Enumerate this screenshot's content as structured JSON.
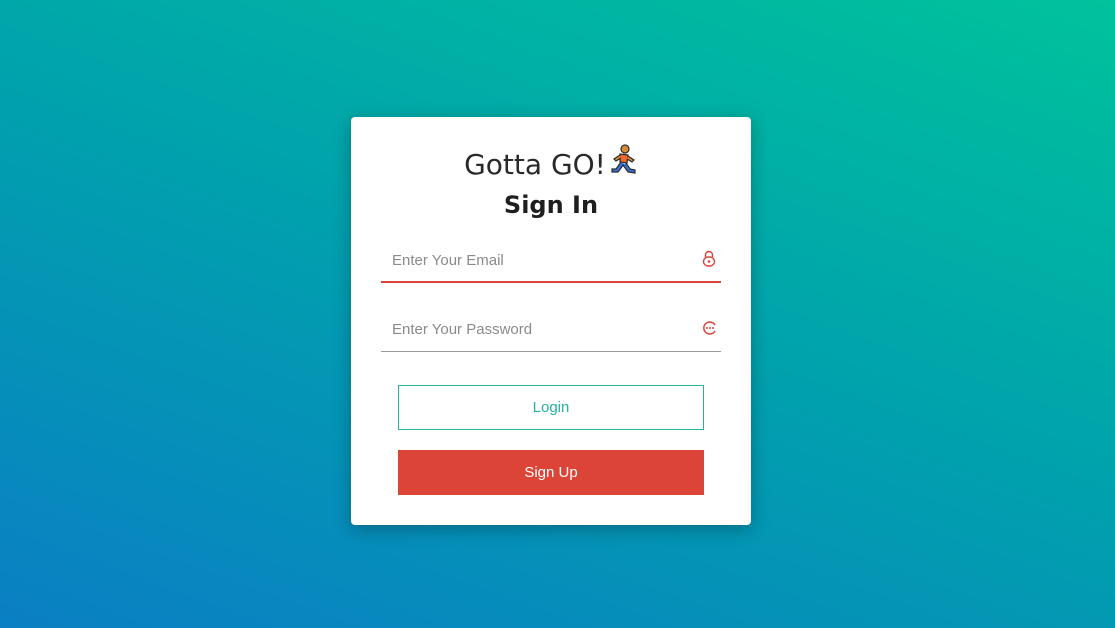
{
  "brand": {
    "title": "Gotta GO!",
    "emoji_icon": "running-person-icon"
  },
  "form": {
    "heading": "Sign In",
    "email": {
      "placeholder": "Enter Your Email",
      "value": "",
      "icon": "lock-icon"
    },
    "password": {
      "placeholder": "Enter Your Password",
      "value": "",
      "icon": "face-icon"
    },
    "login_label": "Login",
    "signup_label": "Sign Up"
  },
  "colors": {
    "accent_red": "#dc4437",
    "accent_teal": "#21b3a3",
    "bg_top": "#00c29c",
    "bg_bottom": "#0a7fc4"
  }
}
